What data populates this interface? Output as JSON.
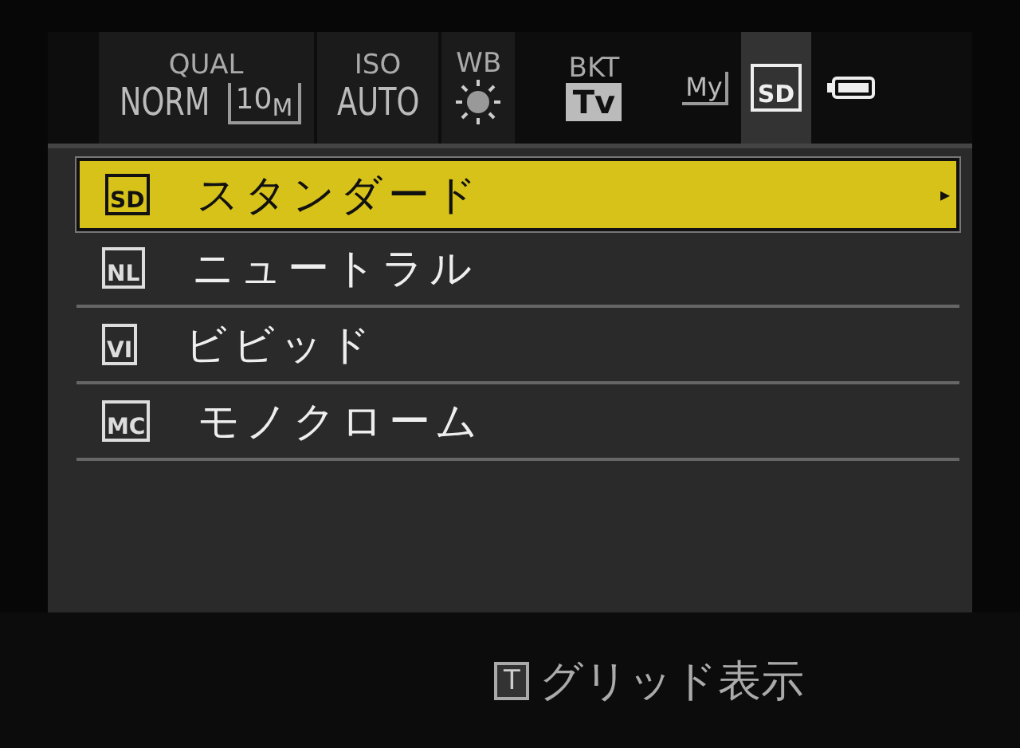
{
  "tabs": [
    {
      "kind": "text",
      "label": "QUAL",
      "value": "NORM",
      "extra": "10$_{M}$",
      "selected": false
    },
    {
      "kind": "text",
      "label": "ISO",
      "value": "AUTO",
      "selected": false
    },
    {
      "kind": "sun",
      "label": "WB",
      "selected": false
    },
    {
      "kind": "badge",
      "label": "BKT",
      "value": "Tv",
      "selected": false
    },
    {
      "kind": "my",
      "label": "My",
      "selected": false
    },
    {
      "kind": "style",
      "label": "SD",
      "selected": true
    }
  ],
  "menu": [
    {
      "code": "SD",
      "label": "スタンダード",
      "selected": true,
      "arrow": "▸"
    },
    {
      "code": "NL",
      "label": "ニュートラル",
      "selected": false
    },
    {
      "code": "VI",
      "label": "ビビッド",
      "selected": false
    },
    {
      "code": "MC",
      "label": "モノクローム",
      "selected": false
    }
  ],
  "hint": {
    "key": "T",
    "label": "グリッド表示"
  }
}
